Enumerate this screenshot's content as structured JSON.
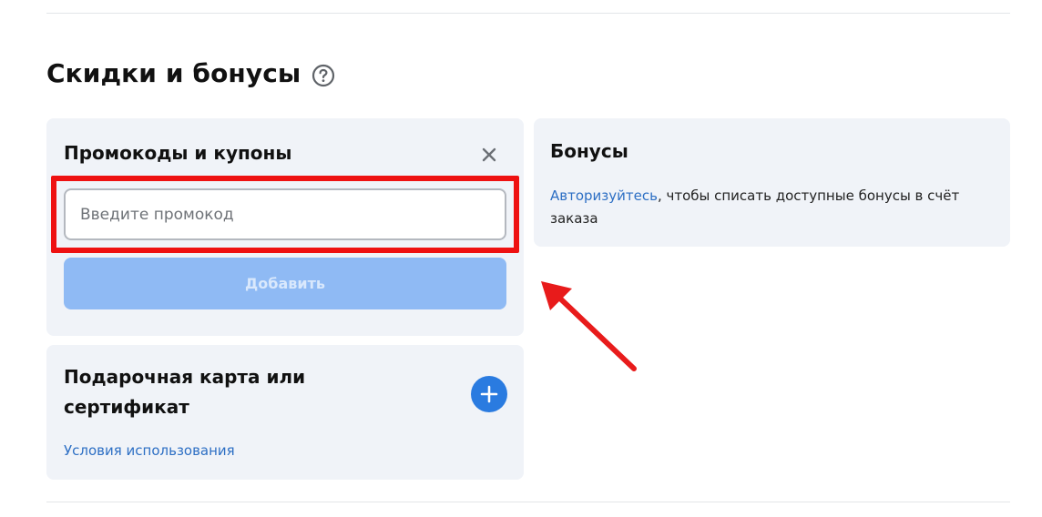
{
  "section": {
    "title": "Скидки и бонусы",
    "help_icon": "question-circle-icon"
  },
  "promo": {
    "title": "Промокоды и купоны",
    "close_icon": "close-icon",
    "input_value": "",
    "input_placeholder": "Введите промокод",
    "add_label": "Добавить"
  },
  "bonus": {
    "title": "Бонусы",
    "login_link": "Авторизуйтесь",
    "text": ", чтобы списать доступные бонусы в счёт заказа"
  },
  "gift": {
    "title": "Подарочная карта или сертификат",
    "add_icon": "plus-circle-icon",
    "terms_link": "Условия использования"
  },
  "colors": {
    "accent": "#2a7be0",
    "link": "#2d6fc4",
    "button_disabled": "#8fbaf4",
    "card_bg": "#f0f3f8",
    "highlight": "#ee1111"
  }
}
